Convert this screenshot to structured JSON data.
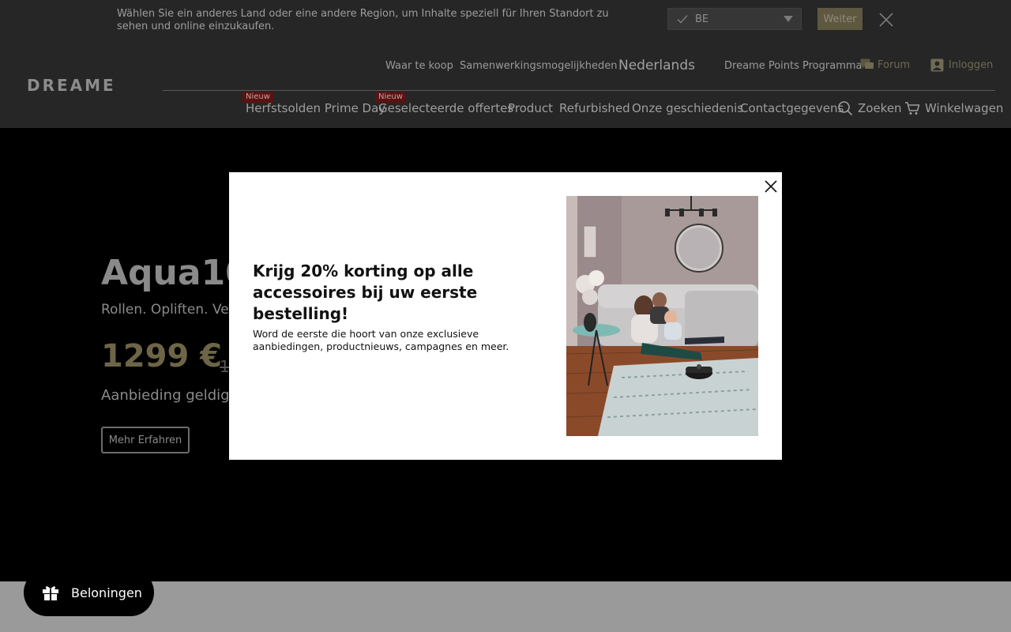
{
  "region_bar": {
    "message": "Wählen Sie ein anderes Land oder eine andere Region, um Inhalte speziell für Ihren Standort zu sehen und online einzukaufen.",
    "selected_country": "BE",
    "continue_label": "Weiter"
  },
  "brand": {
    "logo_text": "DREAME"
  },
  "topnav": {
    "where_to_buy": "Waar te koop",
    "partnerships": "Samenwerkingsmogelijkheden",
    "language": "Nederlands",
    "points": "Dreame Points Programma",
    "forum": "Forum",
    "login": "Inloggen"
  },
  "mainnav": {
    "badge_new": "Nieuw",
    "items": [
      "Herfstsolden Prime Day",
      "Geselecteerde offertes",
      "Product",
      "Refurbished",
      "Onze geschiedenis",
      "Contactgegevens"
    ],
    "search": "Zoeken",
    "cart": "Winkelwagen"
  },
  "hero": {
    "title": "Aqua10 I",
    "subtitle": "Rollen. Opliften. Ver",
    "price": "1299 €",
    "old_price": "1",
    "offer": "Aanbieding geldig:va",
    "cta": "Mehr Erfahren"
  },
  "modal": {
    "heading": "Krijg 20% korting op alle accessoires bij uw eerste bestelling!",
    "text": "Word de eerste die hoort van onze exclusieve aanbiedingen, productnieuws, campagnes en meer."
  },
  "rewards": {
    "label": "Beloningen"
  },
  "colors": {
    "header_bg": "#262626",
    "hero_bg": "#000000",
    "accent_gold": "#6e6548",
    "badge_red": "#5a1212",
    "modal_bg": "#ffffff"
  },
  "icons": [
    "check-icon",
    "caret-down-icon",
    "close-icon",
    "forum-icon",
    "user-icon",
    "search-icon",
    "cart-icon",
    "gift-icon"
  ]
}
